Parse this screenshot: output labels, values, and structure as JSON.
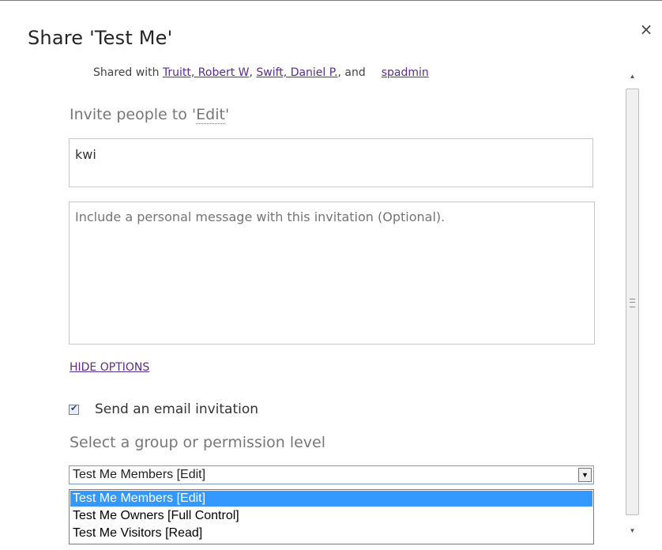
{
  "dialog": {
    "title": "Share 'Test Me'",
    "close_glyph": "×"
  },
  "shared_with": {
    "prefix": "Shared with ",
    "users": [
      "Truitt, Robert W",
      "Swift, Daniel P."
    ],
    "separator": ", ",
    "conjunction": ", and",
    "last_user": "spadmin"
  },
  "invite": {
    "label_prefix": "Invite people to '",
    "permission_link": "Edit",
    "label_suffix": "'",
    "people_value": "kwi",
    "message_placeholder": "Include a personal message with this invitation (Optional)."
  },
  "options": {
    "hide_options_label": "HIDE OPTIONS",
    "send_email_label": "Send an email invitation",
    "send_email_checked": true,
    "permission_label": "Select a group or permission level",
    "selected_value": "Test Me Members [Edit]",
    "dropdown_options": [
      "Test Me Members [Edit]",
      "Test Me Owners [Full Control]",
      "Test Me Visitors [Read]"
    ],
    "highlighted_index": 0
  },
  "icons": {
    "close": "close-icon",
    "checkbox": "checkmark-icon",
    "select_arrow": "chevron-down-icon",
    "scroll_up": "scroll-up-arrow-icon",
    "scroll_down": "scroll-down-arrow-icon",
    "scroll_grip": "grip-icon"
  },
  "colors": {
    "link": "#5b2c8a",
    "selection": "#3399ff",
    "muted_label": "#777777"
  }
}
